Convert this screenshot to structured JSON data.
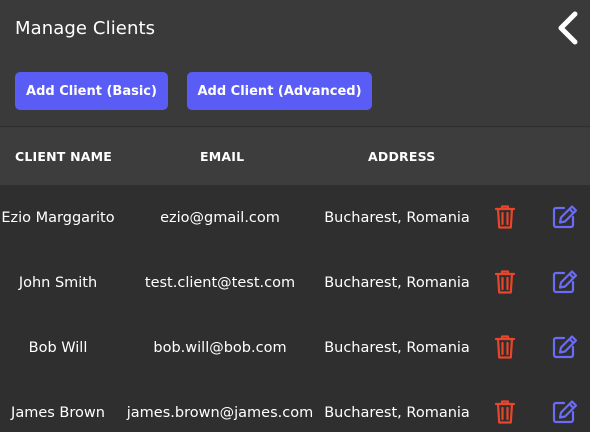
{
  "page": {
    "title": "Manage Clients"
  },
  "buttons": {
    "add_basic": "Add Client (Basic)",
    "add_advanced": "Add Client (Advanced)"
  },
  "table": {
    "headers": {
      "name": "CLIENT NAME",
      "email": "EMAIL",
      "address": "ADDRESS"
    },
    "rows": [
      {
        "name": "Ezio Marggarito",
        "email": "ezio@gmail.com",
        "address": "Bucharest, Romania"
      },
      {
        "name": "John Smith",
        "email": "test.client@test.com",
        "address": "Bucharest, Romania"
      },
      {
        "name": "Bob Will",
        "email": "bob.will@bob.com",
        "address": "Bucharest, Romania"
      },
      {
        "name": "James Brown",
        "email": "james.brown@james.com",
        "address": "Bucharest, Romania"
      }
    ]
  },
  "icons": {
    "back": "chevron-left-icon",
    "delete": "trash-icon",
    "edit": "edit-icon"
  },
  "colors": {
    "accent": "#5a5cf6",
    "delete": "#e8452a",
    "edit": "#6a6cf6",
    "header_bg": "#3a3a3a",
    "table_bg": "#2f2f2f"
  }
}
